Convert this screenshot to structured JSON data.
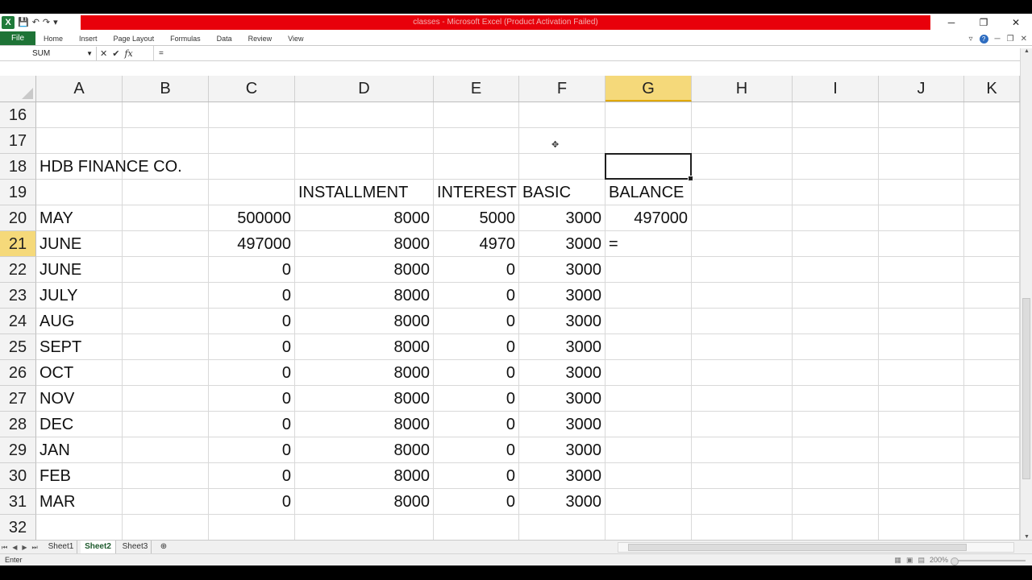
{
  "window": {
    "title": "classes - Microsoft Excel (Product Activation Failed)",
    "controls": [
      "─",
      "❐",
      "✕"
    ]
  },
  "qat": {
    "logo": "X",
    "save": "💾",
    "undo": "↶",
    "redo": "↷",
    "more": "▾"
  },
  "ribbon": {
    "file_tab": "File",
    "tabs": [
      "Home",
      "Insert",
      "Page Layout",
      "Formulas",
      "Data",
      "Review",
      "View"
    ],
    "right_icons": [
      "▿",
      "?",
      "─",
      "❐",
      "✕"
    ]
  },
  "formula_bar": {
    "name_box": "SUM",
    "cancel": "✕",
    "enter": "✔",
    "fx": "fx",
    "content": "="
  },
  "columns": [
    {
      "label": "A",
      "selected": false
    },
    {
      "label": "B",
      "selected": false
    },
    {
      "label": "C",
      "selected": false
    },
    {
      "label": "D",
      "selected": false
    },
    {
      "label": "E",
      "selected": false
    },
    {
      "label": "F",
      "selected": false
    },
    {
      "label": "G",
      "selected": true
    },
    {
      "label": "H",
      "selected": false
    },
    {
      "label": "I",
      "selected": false
    },
    {
      "label": "J",
      "selected": false
    },
    {
      "label": "K",
      "selected": false
    }
  ],
  "rows": [
    {
      "n": "16",
      "cells": [
        "",
        "",
        "",
        "",
        "",
        "",
        "",
        "",
        "",
        "",
        ""
      ]
    },
    {
      "n": "17",
      "cells": [
        "",
        "",
        "",
        "",
        "",
        "",
        "",
        "",
        "",
        "",
        ""
      ]
    },
    {
      "n": "18",
      "cells": [
        "HDB FINANCE CO.",
        "",
        "",
        "",
        "",
        "",
        "",
        "",
        "",
        "",
        ""
      ]
    },
    {
      "n": "19",
      "cells": [
        "",
        "",
        "",
        "INSTALLMENT",
        "INTEREST",
        "BASIC",
        "BALANCE",
        "",
        "",
        "",
        ""
      ]
    },
    {
      "n": "20",
      "cells": [
        "MAY",
        "",
        "500000",
        "8000",
        "5000",
        "3000",
        "497000",
        "",
        "",
        "",
        ""
      ]
    },
    {
      "n": "21",
      "cells": [
        "JUNE",
        "",
        "497000",
        "8000",
        "4970",
        "3000",
        "=",
        "",
        "",
        "",
        ""
      ],
      "selected": true
    },
    {
      "n": "22",
      "cells": [
        "JUNE",
        "",
        "0",
        "8000",
        "0",
        "3000",
        "",
        "",
        "",
        "",
        ""
      ]
    },
    {
      "n": "23",
      "cells": [
        "JULY",
        "",
        "0",
        "8000",
        "0",
        "3000",
        "",
        "",
        "",
        "",
        ""
      ]
    },
    {
      "n": "24",
      "cells": [
        "AUG",
        "",
        "0",
        "8000",
        "0",
        "3000",
        "",
        "",
        "",
        "",
        ""
      ]
    },
    {
      "n": "25",
      "cells": [
        "SEPT",
        "",
        "0",
        "8000",
        "0",
        "3000",
        "",
        "",
        "",
        "",
        ""
      ]
    },
    {
      "n": "26",
      "cells": [
        "OCT",
        "",
        "0",
        "8000",
        "0",
        "3000",
        "",
        "",
        "",
        "",
        ""
      ]
    },
    {
      "n": "27",
      "cells": [
        "NOV",
        "",
        "0",
        "8000",
        "0",
        "3000",
        "",
        "",
        "",
        "",
        ""
      ]
    },
    {
      "n": "28",
      "cells": [
        "DEC",
        "",
        "0",
        "8000",
        "0",
        "3000",
        "",
        "",
        "",
        "",
        ""
      ]
    },
    {
      "n": "29",
      "cells": [
        "JAN",
        "",
        "0",
        "8000",
        "0",
        "3000",
        "",
        "",
        "",
        "",
        ""
      ]
    },
    {
      "n": "30",
      "cells": [
        "FEB",
        "",
        "0",
        "8000",
        "0",
        "3000",
        "",
        "",
        "",
        "",
        ""
      ]
    },
    {
      "n": "31",
      "cells": [
        "MAR",
        "",
        "0",
        "8000",
        "0",
        "3000",
        "",
        "",
        "",
        "",
        ""
      ]
    },
    {
      "n": "32",
      "cells": [
        "",
        "",
        "",
        "",
        "",
        "",
        "",
        "",
        "",
        "",
        ""
      ]
    }
  ],
  "sheets": {
    "nav": [
      "⏮",
      "◀",
      "▶",
      "⏭"
    ],
    "tabs": [
      {
        "label": "Sheet1",
        "active": false
      },
      {
        "label": "Sheet2",
        "active": true
      },
      {
        "label": "Sheet3",
        "active": false
      }
    ],
    "new_sheet": "⊕"
  },
  "status": {
    "mode": "Enter",
    "zoom": "200%"
  }
}
